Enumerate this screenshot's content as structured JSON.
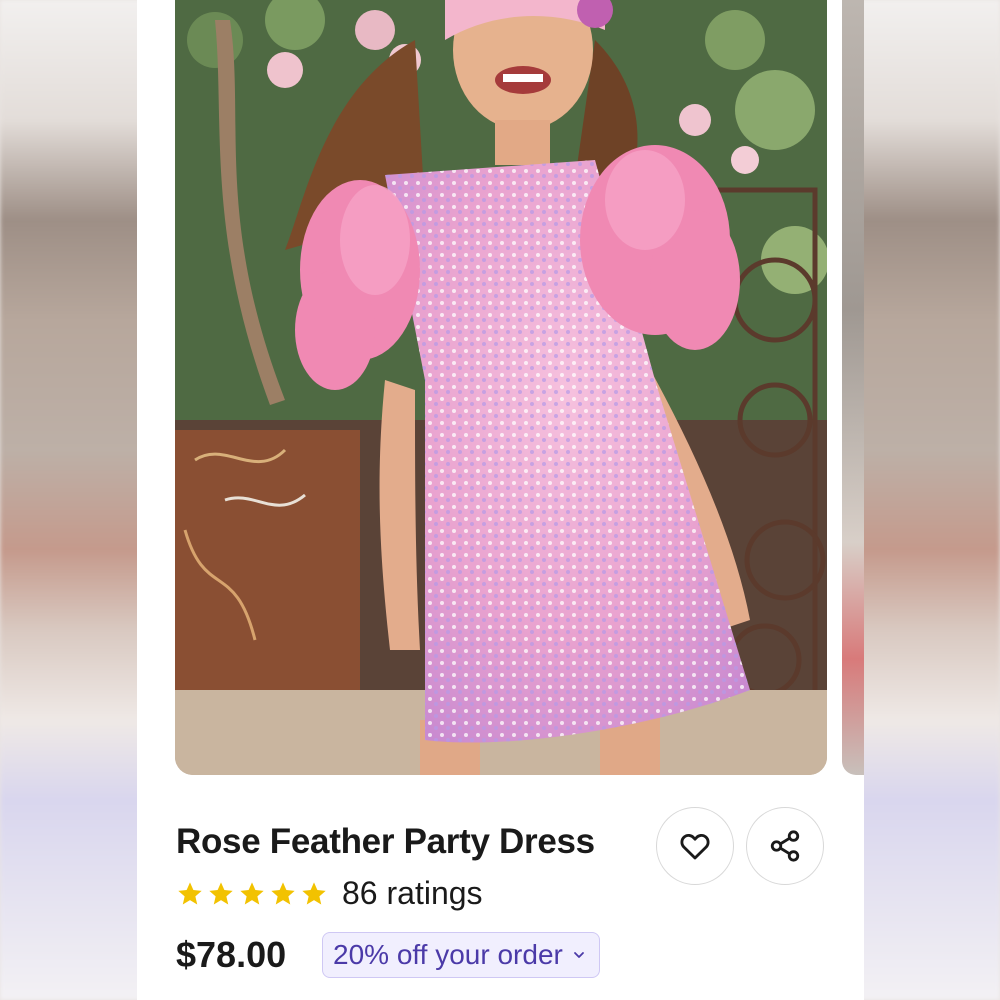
{
  "product": {
    "title": "Rose Feather Party Dress",
    "rating_count_text": "86 ratings",
    "rating_value": 5,
    "price": "$78.00",
    "promo_text": "20% off your order"
  },
  "icons": {
    "favorite": "heart-icon",
    "share": "share-icon",
    "promo_toggle": "chevron-down-icon",
    "star": "star-icon"
  },
  "colors": {
    "star": "#f2c200",
    "promo_text": "#4b3aa8",
    "promo_bg": "#f1effe",
    "dress": "#f3a6cf"
  }
}
